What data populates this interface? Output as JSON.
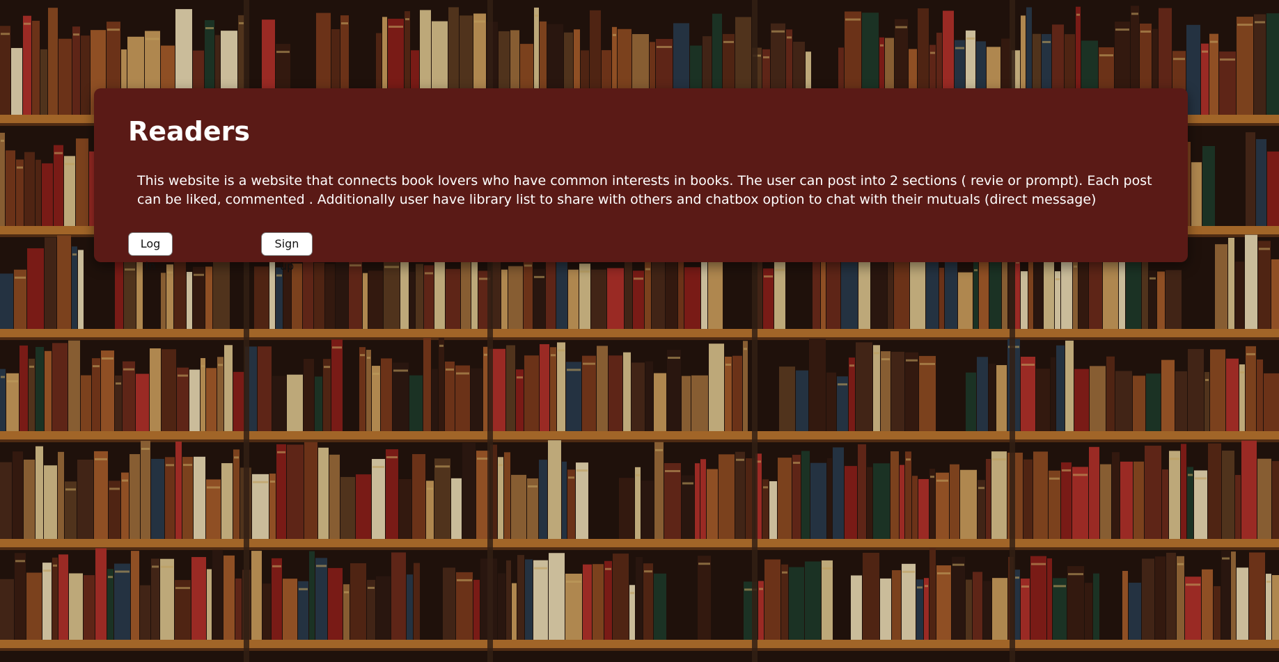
{
  "hero": {
    "title": "Readers",
    "description": "This website is a website that connects book lovers who have common interests in books. The user can post into 2 sections ( revie or prompt). Each post can be liked, commented . Additionally user have library list to share with others and chatbox option to chat with their mutuals (direct message)",
    "login_label": "Log In",
    "signup_label": "Sign up"
  },
  "background": {
    "image": "bookshelf-photo"
  },
  "colors": {
    "card": "#5a1a16",
    "text": "#ffffff",
    "button_bg": "#ffffff"
  }
}
